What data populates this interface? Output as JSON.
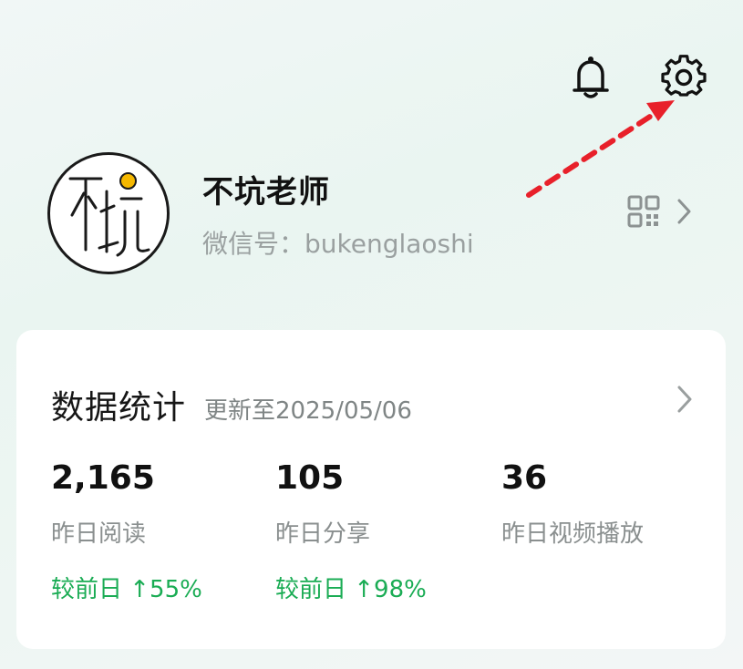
{
  "header": {
    "bell_icon": "bell-icon",
    "settings_icon": "gear-icon"
  },
  "annotation": {
    "arrow_color": "#e8202a"
  },
  "profile": {
    "name": "不坑老师",
    "wechat_id": "微信号：bukenglaoshi",
    "avatar_accent": "#f5b800",
    "qr_icon": "qr-code-icon"
  },
  "stats": {
    "title": "数据统计",
    "updated": "更新至2025/05/06",
    "items": [
      {
        "value": "2,165",
        "label": "昨日阅读",
        "change": "较前日 ↑55%"
      },
      {
        "value": "105",
        "label": "昨日分享",
        "change": "较前日 ↑98%"
      },
      {
        "value": "36",
        "label": "昨日视频播放",
        "change": ""
      }
    ],
    "positive_color": "#1aac54"
  }
}
